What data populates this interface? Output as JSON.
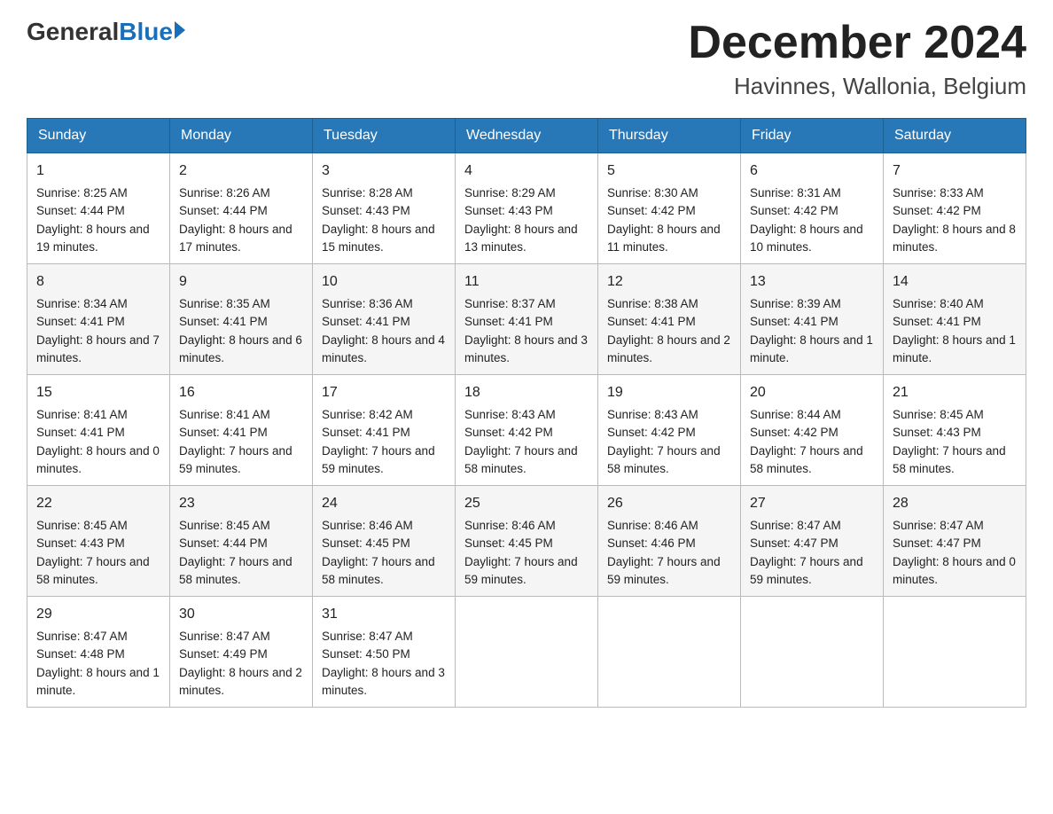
{
  "header": {
    "logo": {
      "general": "General",
      "blue": "Blue"
    },
    "title": "December 2024",
    "location": "Havinnes, Wallonia, Belgium"
  },
  "columns": [
    "Sunday",
    "Monday",
    "Tuesday",
    "Wednesday",
    "Thursday",
    "Friday",
    "Saturday"
  ],
  "weeks": [
    [
      {
        "day": "1",
        "sunrise": "Sunrise: 8:25 AM",
        "sunset": "Sunset: 4:44 PM",
        "daylight": "Daylight: 8 hours and 19 minutes."
      },
      {
        "day": "2",
        "sunrise": "Sunrise: 8:26 AM",
        "sunset": "Sunset: 4:44 PM",
        "daylight": "Daylight: 8 hours and 17 minutes."
      },
      {
        "day": "3",
        "sunrise": "Sunrise: 8:28 AM",
        "sunset": "Sunset: 4:43 PM",
        "daylight": "Daylight: 8 hours and 15 minutes."
      },
      {
        "day": "4",
        "sunrise": "Sunrise: 8:29 AM",
        "sunset": "Sunset: 4:43 PM",
        "daylight": "Daylight: 8 hours and 13 minutes."
      },
      {
        "day": "5",
        "sunrise": "Sunrise: 8:30 AM",
        "sunset": "Sunset: 4:42 PM",
        "daylight": "Daylight: 8 hours and 11 minutes."
      },
      {
        "day": "6",
        "sunrise": "Sunrise: 8:31 AM",
        "sunset": "Sunset: 4:42 PM",
        "daylight": "Daylight: 8 hours and 10 minutes."
      },
      {
        "day": "7",
        "sunrise": "Sunrise: 8:33 AM",
        "sunset": "Sunset: 4:42 PM",
        "daylight": "Daylight: 8 hours and 8 minutes."
      }
    ],
    [
      {
        "day": "8",
        "sunrise": "Sunrise: 8:34 AM",
        "sunset": "Sunset: 4:41 PM",
        "daylight": "Daylight: 8 hours and 7 minutes."
      },
      {
        "day": "9",
        "sunrise": "Sunrise: 8:35 AM",
        "sunset": "Sunset: 4:41 PM",
        "daylight": "Daylight: 8 hours and 6 minutes."
      },
      {
        "day": "10",
        "sunrise": "Sunrise: 8:36 AM",
        "sunset": "Sunset: 4:41 PM",
        "daylight": "Daylight: 8 hours and 4 minutes."
      },
      {
        "day": "11",
        "sunrise": "Sunrise: 8:37 AM",
        "sunset": "Sunset: 4:41 PM",
        "daylight": "Daylight: 8 hours and 3 minutes."
      },
      {
        "day": "12",
        "sunrise": "Sunrise: 8:38 AM",
        "sunset": "Sunset: 4:41 PM",
        "daylight": "Daylight: 8 hours and 2 minutes."
      },
      {
        "day": "13",
        "sunrise": "Sunrise: 8:39 AM",
        "sunset": "Sunset: 4:41 PM",
        "daylight": "Daylight: 8 hours and 1 minute."
      },
      {
        "day": "14",
        "sunrise": "Sunrise: 8:40 AM",
        "sunset": "Sunset: 4:41 PM",
        "daylight": "Daylight: 8 hours and 1 minute."
      }
    ],
    [
      {
        "day": "15",
        "sunrise": "Sunrise: 8:41 AM",
        "sunset": "Sunset: 4:41 PM",
        "daylight": "Daylight: 8 hours and 0 minutes."
      },
      {
        "day": "16",
        "sunrise": "Sunrise: 8:41 AM",
        "sunset": "Sunset: 4:41 PM",
        "daylight": "Daylight: 7 hours and 59 minutes."
      },
      {
        "day": "17",
        "sunrise": "Sunrise: 8:42 AM",
        "sunset": "Sunset: 4:41 PM",
        "daylight": "Daylight: 7 hours and 59 minutes."
      },
      {
        "day": "18",
        "sunrise": "Sunrise: 8:43 AM",
        "sunset": "Sunset: 4:42 PM",
        "daylight": "Daylight: 7 hours and 58 minutes."
      },
      {
        "day": "19",
        "sunrise": "Sunrise: 8:43 AM",
        "sunset": "Sunset: 4:42 PM",
        "daylight": "Daylight: 7 hours and 58 minutes."
      },
      {
        "day": "20",
        "sunrise": "Sunrise: 8:44 AM",
        "sunset": "Sunset: 4:42 PM",
        "daylight": "Daylight: 7 hours and 58 minutes."
      },
      {
        "day": "21",
        "sunrise": "Sunrise: 8:45 AM",
        "sunset": "Sunset: 4:43 PM",
        "daylight": "Daylight: 7 hours and 58 minutes."
      }
    ],
    [
      {
        "day": "22",
        "sunrise": "Sunrise: 8:45 AM",
        "sunset": "Sunset: 4:43 PM",
        "daylight": "Daylight: 7 hours and 58 minutes."
      },
      {
        "day": "23",
        "sunrise": "Sunrise: 8:45 AM",
        "sunset": "Sunset: 4:44 PM",
        "daylight": "Daylight: 7 hours and 58 minutes."
      },
      {
        "day": "24",
        "sunrise": "Sunrise: 8:46 AM",
        "sunset": "Sunset: 4:45 PM",
        "daylight": "Daylight: 7 hours and 58 minutes."
      },
      {
        "day": "25",
        "sunrise": "Sunrise: 8:46 AM",
        "sunset": "Sunset: 4:45 PM",
        "daylight": "Daylight: 7 hours and 59 minutes."
      },
      {
        "day": "26",
        "sunrise": "Sunrise: 8:46 AM",
        "sunset": "Sunset: 4:46 PM",
        "daylight": "Daylight: 7 hours and 59 minutes."
      },
      {
        "day": "27",
        "sunrise": "Sunrise: 8:47 AM",
        "sunset": "Sunset: 4:47 PM",
        "daylight": "Daylight: 7 hours and 59 minutes."
      },
      {
        "day": "28",
        "sunrise": "Sunrise: 8:47 AM",
        "sunset": "Sunset: 4:47 PM",
        "daylight": "Daylight: 8 hours and 0 minutes."
      }
    ],
    [
      {
        "day": "29",
        "sunrise": "Sunrise: 8:47 AM",
        "sunset": "Sunset: 4:48 PM",
        "daylight": "Daylight: 8 hours and 1 minute."
      },
      {
        "day": "30",
        "sunrise": "Sunrise: 8:47 AM",
        "sunset": "Sunset: 4:49 PM",
        "daylight": "Daylight: 8 hours and 2 minutes."
      },
      {
        "day": "31",
        "sunrise": "Sunrise: 8:47 AM",
        "sunset": "Sunset: 4:50 PM",
        "daylight": "Daylight: 8 hours and 3 minutes."
      },
      null,
      null,
      null,
      null
    ]
  ]
}
